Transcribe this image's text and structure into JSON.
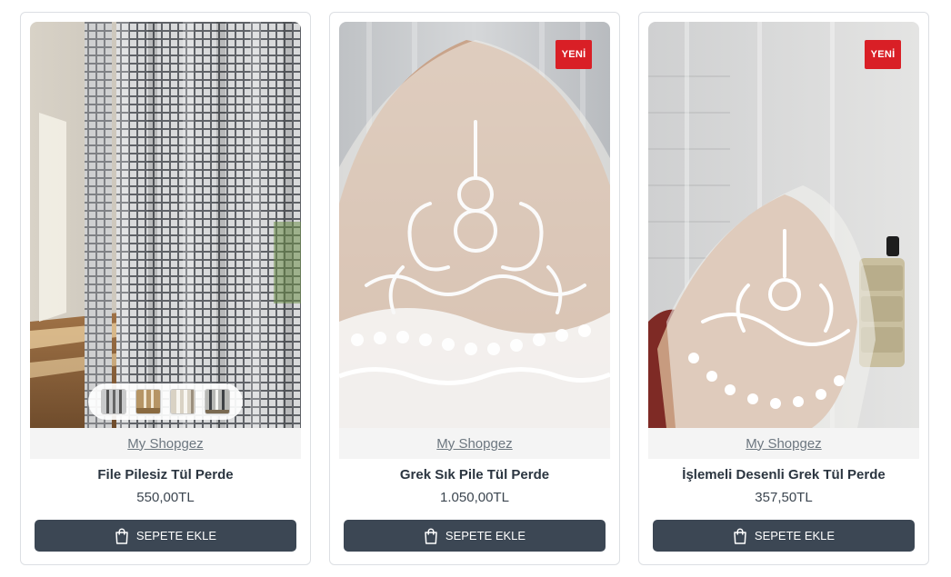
{
  "products": [
    {
      "name": "File Pilesiz Tül Perde",
      "price": "550,00TL",
      "brand": "My Shopgez",
      "button": "SEPETE EKLE",
      "badge": "",
      "thumbnails": 4
    },
    {
      "name": "Grek Sık Pile Tül Perde",
      "price": "1.050,00TL",
      "brand": "My Shopgez",
      "button": "SEPETE EKLE",
      "badge": "YENİ"
    },
    {
      "name": "İşlemeli Desenli Grek Tül Perde",
      "price": "357,50TL",
      "brand": "My Shopgez",
      "button": "SEPETE EKLE",
      "badge": "YENİ"
    }
  ],
  "colors": {
    "badge": "#d91f26",
    "button": "#3c4754",
    "border": "#dcdfe3"
  },
  "icons": {
    "button_icon": "shopping-bag-icon"
  }
}
